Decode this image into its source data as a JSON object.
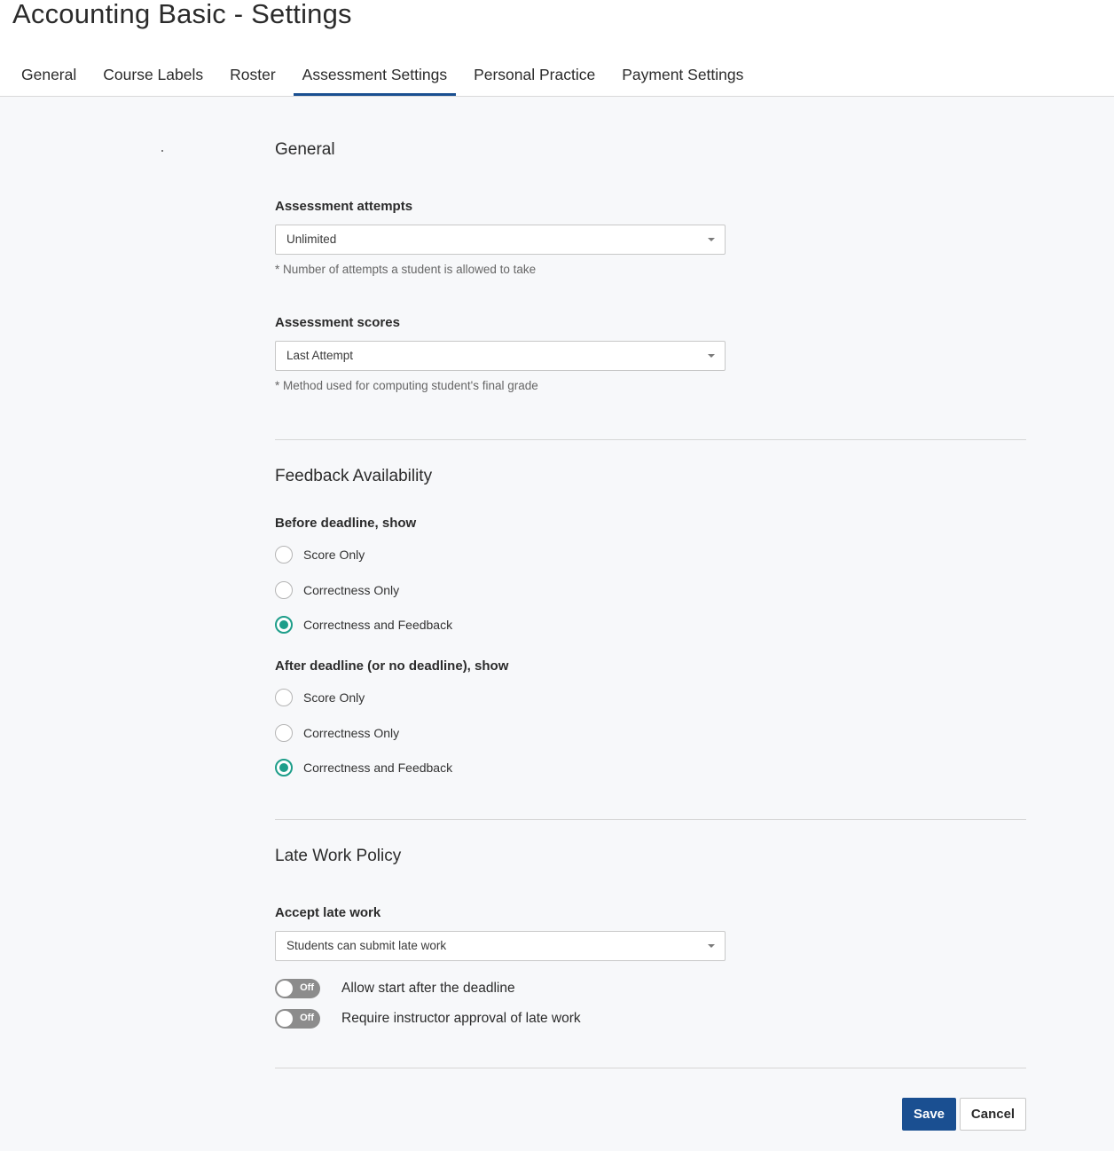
{
  "header": {
    "title": "Accounting Basic - Settings",
    "tabs": [
      {
        "label": "General"
      },
      {
        "label": "Course Labels"
      },
      {
        "label": "Roster"
      },
      {
        "label": "Assessment Settings",
        "active": true
      },
      {
        "label": "Personal Practice"
      },
      {
        "label": "Payment Settings"
      }
    ]
  },
  "general": {
    "title": "General",
    "attempts": {
      "label": "Assessment attempts",
      "value": "Unlimited",
      "hint": "* Number of attempts a student is allowed to take"
    },
    "scores": {
      "label": "Assessment scores",
      "value": "Last Attempt",
      "hint": "* Method used for computing student's final grade"
    }
  },
  "feedback": {
    "title": "Feedback Availability",
    "before": {
      "label": "Before deadline, show",
      "options": [
        "Score Only",
        "Correctness Only",
        "Correctness and Feedback"
      ],
      "selected": "Correctness and Feedback"
    },
    "after": {
      "label": "After deadline (or no deadline), show",
      "options": [
        "Score Only",
        "Correctness Only",
        "Correctness and Feedback"
      ],
      "selected": "Correctness and Feedback"
    }
  },
  "late_work": {
    "title": "Late Work Policy",
    "accept": {
      "label": "Accept late work",
      "value": "Students can submit late work"
    },
    "toggles": [
      {
        "label": "Allow start after the deadline",
        "state": "Off"
      },
      {
        "label": "Require instructor approval of late work",
        "state": "Off"
      }
    ]
  },
  "actions": {
    "save_label": "Save",
    "cancel_label": "Cancel"
  },
  "colors": {
    "accent": "#1a4f91",
    "radio_selected": "#1e9e8a",
    "toggle_off": "#8c8c8c"
  }
}
